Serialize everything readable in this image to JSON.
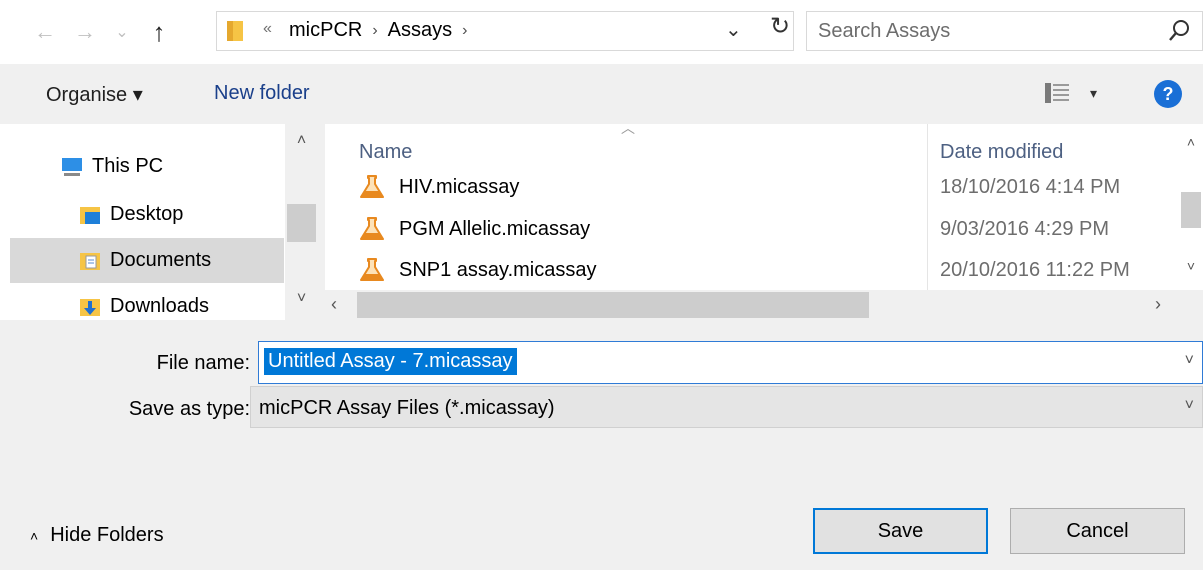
{
  "nav": {
    "back": "←",
    "forward": "→",
    "recent": "⌄",
    "up": "↑"
  },
  "address": {
    "overflow": "«",
    "crumbs": [
      "micPCR",
      "Assays"
    ],
    "separator": "›",
    "dropdown": "⌄",
    "refresh": "↻"
  },
  "search": {
    "placeholder": "Search Assays"
  },
  "toolbar": {
    "organise": "Organise ▾",
    "new_folder": "New folder",
    "view_caret": "▾",
    "help": "?"
  },
  "sidebar": {
    "items": [
      {
        "label": "This PC",
        "icon": "computer-icon"
      },
      {
        "label": "Desktop",
        "icon": "desktop-folder-icon"
      },
      {
        "label": "Documents",
        "icon": "documents-folder-icon",
        "selected": true
      },
      {
        "label": "Downloads",
        "icon": "downloads-folder-icon"
      }
    ],
    "scroll_up": "˄",
    "scroll_down": "˅"
  },
  "files": {
    "sort_indicator": "︿",
    "columns": {
      "name": "Name",
      "date": "Date modified"
    },
    "rows": [
      {
        "name": "HIV.micassay",
        "date": "18/10/2016 4:14 PM"
      },
      {
        "name": "PGM Allelic.micassay",
        "date": "9/03/2016 4:29 PM"
      },
      {
        "name": "SNP1 assay.micassay",
        "date": "20/10/2016 11:22 PM"
      }
    ],
    "scroll_up": "˄",
    "scroll_down": "˅",
    "scroll_left": "‹",
    "scroll_right": "›"
  },
  "form": {
    "file_name_label": "File name:",
    "file_name_value": "Untitled Assay - 7.micassay",
    "save_type_label": "Save as type:",
    "save_type_value": "micPCR Assay Files (*.micassay)",
    "chevron": "˅"
  },
  "footer": {
    "hide_folders_caret": "˄",
    "hide_folders": "Hide Folders",
    "save": "Save",
    "cancel": "Cancel"
  },
  "colors": {
    "accent": "#0078d7",
    "selection": "#d9d9d9",
    "link": "#1a3f8a",
    "flask": "#e8891f"
  }
}
